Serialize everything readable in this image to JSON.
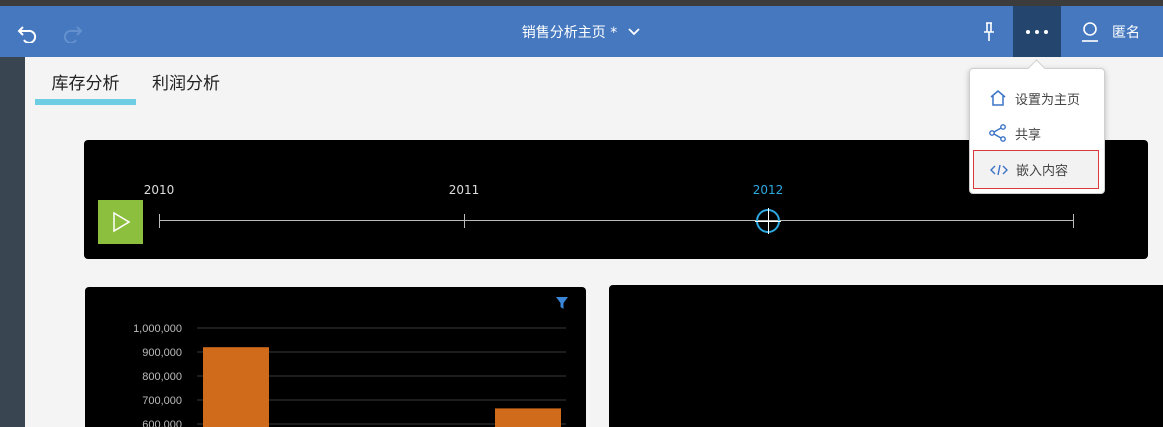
{
  "header": {
    "title": "销售分析主页 *",
    "user_label": "匿名"
  },
  "tabs": [
    {
      "label": "库存分析",
      "active": true
    },
    {
      "label": "利润分析",
      "active": false
    }
  ],
  "timeline": {
    "years": [
      "2010",
      "2011",
      "2012"
    ],
    "selected": "2012"
  },
  "menu": {
    "items": [
      {
        "label": "设置为主页",
        "icon": "home-icon"
      },
      {
        "label": "共享",
        "icon": "share-icon"
      },
      {
        "label": "嵌入内容",
        "icon": "code-icon"
      }
    ]
  },
  "colors": {
    "header": "#4578bf",
    "accent_tab": "#6ecde3",
    "bar": "#d06b1c",
    "play": "#8dbf3f",
    "timeline_active": "#2ea8e0",
    "menu_highlight_border": "#d9393a"
  },
  "chart_data": {
    "type": "bar",
    "categories": [
      "",
      ""
    ],
    "values": [
      920000,
      665000
    ],
    "ylim": [
      600000,
      1000000
    ],
    "yticks": [
      "1,000,000",
      "900,000",
      "800,000",
      "700,000",
      "600,000"
    ],
    "ylabel": ""
  }
}
